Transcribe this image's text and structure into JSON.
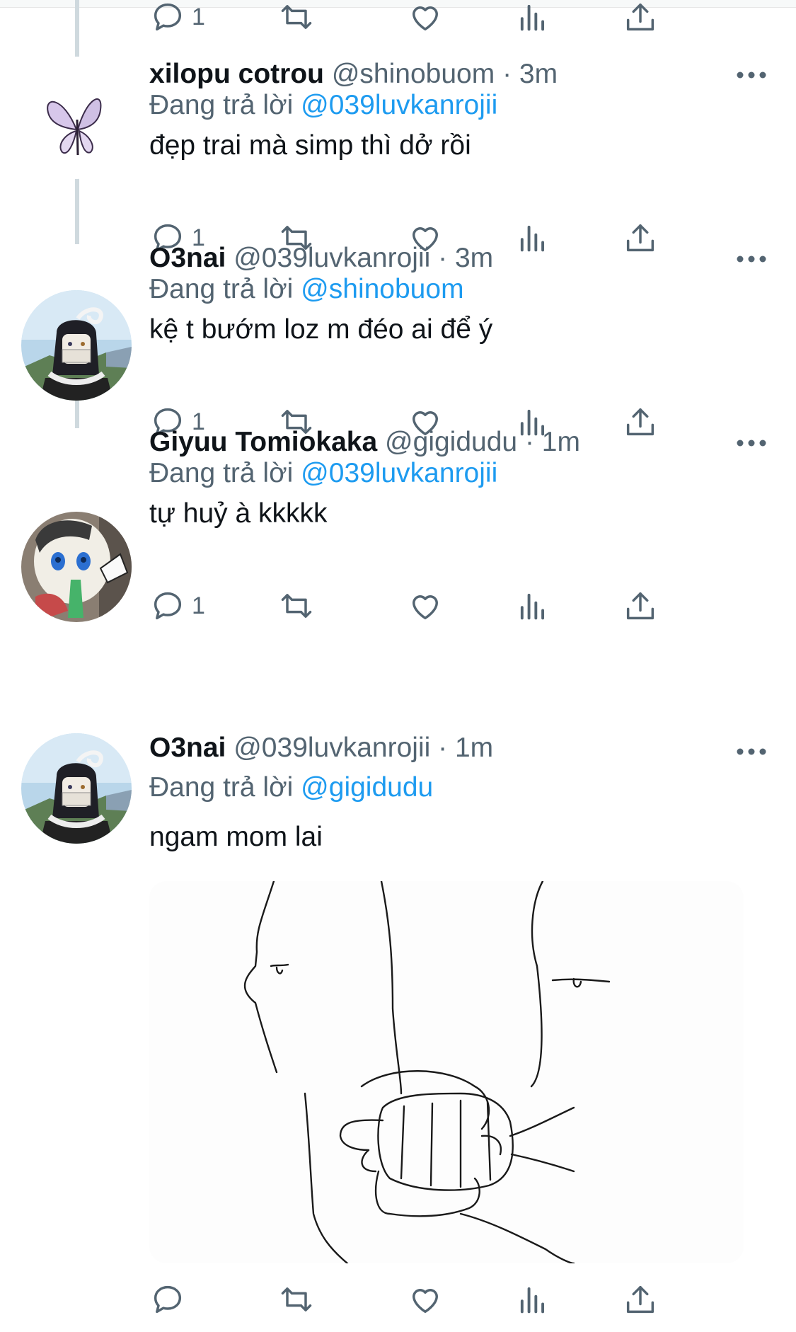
{
  "reply_prefix": "Đang trả lời",
  "tweets": [
    {
      "name": "",
      "handle": "",
      "time": "",
      "reply_to": "",
      "text": "",
      "counts": {
        "reply": "1",
        "retweet": "",
        "like": ""
      }
    },
    {
      "name": "xilopu cotrou",
      "handle": "@shinobuom",
      "time": "· 3m",
      "reply_to": "@039luvkanrojii",
      "text": "đẹp trai mà simp thì dở rồi",
      "counts": {
        "reply": "1",
        "retweet": "",
        "like": ""
      },
      "avatar_icon": "butterfly-avatar"
    },
    {
      "name": "O3nai",
      "handle": "@039luvkanrojii",
      "time": "· 3m",
      "reply_to": "@shinobuom",
      "text": "kệ t bướm loz m đéo ai để ý",
      "counts": {
        "reply": "1",
        "retweet": "",
        "like": ""
      },
      "avatar_icon": "anime-character-avatar"
    },
    {
      "name": "Giyuu Tomiokaka",
      "handle": "@gigidudu",
      "time": "· 1m",
      "reply_to": "@039luvkanrojii",
      "text": "tự huỷ à kkkkk",
      "counts": {
        "reply": "1",
        "retweet": "",
        "like": ""
      },
      "avatar_icon": "plush-doll-avatar"
    },
    {
      "name": "O3nai",
      "handle": "@039luvkanrojii",
      "time": "· 1m",
      "reply_to": "@gigidudu",
      "text": "ngam mom lai",
      "counts": {
        "reply": "",
        "retweet": "",
        "like": ""
      },
      "avatar_icon": "anime-character-avatar",
      "media_icon": "line-drawing-punch-image"
    }
  ],
  "colors": {
    "link": "#1d9bf0",
    "secondary_text": "#536471",
    "thread_line": "#cfd9de"
  }
}
